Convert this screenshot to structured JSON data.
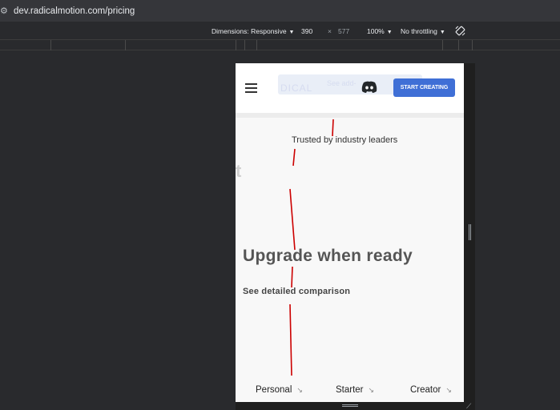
{
  "browser": {
    "url": "dev.radicalmotion.com/pricing"
  },
  "devtools": {
    "dimensions_label": "Dimensions: Responsive",
    "width_value": "390",
    "times": "×",
    "height_value": "577",
    "zoom_label": "100%",
    "throttling_label": "No throttling"
  },
  "site": {
    "logo_text": "DICAL",
    "addons_text": "See add-",
    "cta_label": "START CREATING",
    "trusted_text": "Trusted by industry leaders",
    "ghost_letter": "t",
    "upgrade_title": "Upgrade when ready",
    "comparison_link": "See detailed comparison",
    "plans": [
      {
        "label": "Personal",
        "arrow": "↘"
      },
      {
        "label": "Starter",
        "arrow": "↘"
      },
      {
        "label": "Creator",
        "arrow": "↘"
      }
    ]
  },
  "colors": {
    "accent": "#3f6fd6",
    "annotation": "#cc0000"
  }
}
